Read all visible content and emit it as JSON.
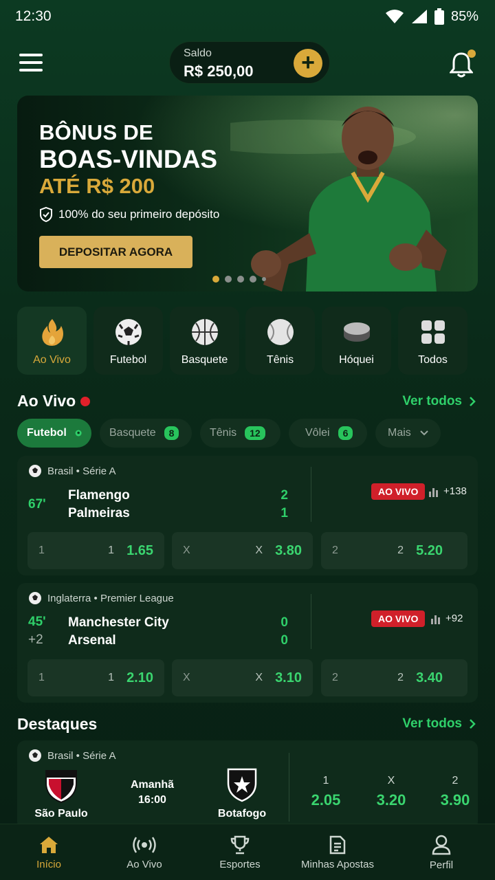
{
  "status_bar": {
    "time": "12:30",
    "battery": "85%"
  },
  "header": {
    "balance_label": "Saldo",
    "balance_value": "R$ 250,00",
    "add_label": "+"
  },
  "banner": {
    "title_line1": "BÔNUS DE",
    "title_line2": "BOAS-VINDAS",
    "title_line3": "ATÉ R$ 200",
    "subtitle": "100% do seu primeiro depósito",
    "cta": "DEPOSITAR AGORA",
    "slides": 5,
    "active_slide": 1
  },
  "categories": [
    {
      "label": "Ao Vivo",
      "icon": "flame-icon",
      "active": true
    },
    {
      "label": "Futebol",
      "icon": "soccer-ball-icon",
      "active": false
    },
    {
      "label": "Basquete",
      "icon": "basketball-icon",
      "active": false
    },
    {
      "label": "Tênis",
      "icon": "tennis-ball-icon",
      "active": false
    },
    {
      "label": "Hóquei",
      "icon": "hockey-puck-icon",
      "active": false
    },
    {
      "label": "Todos",
      "icon": "grid-icon",
      "active": false
    }
  ],
  "live": {
    "title": "Ao Vivo",
    "see_all": "Ver todos",
    "chips": [
      {
        "label": "Futebol",
        "count": "",
        "active": true
      },
      {
        "label": "Basquete",
        "count": "8",
        "active": false
      },
      {
        "label": "Tênis",
        "count": "12",
        "active": false
      },
      {
        "label": "Vôlei",
        "count": "6",
        "active": false
      },
      {
        "label": "Mais",
        "count": "",
        "active": false
      }
    ],
    "matches": [
      {
        "league": "Brasil • Série A",
        "minute": "67'",
        "extra": "",
        "home": "Flamengo",
        "away": "Palmeiras",
        "home_score": "2",
        "away_score": "1",
        "badge": "AO VIVO",
        "markets": "+138",
        "odds": [
          {
            "key": "1",
            "key2": "1",
            "value": "1.65"
          },
          {
            "key": "X",
            "key2": "X",
            "value": "3.80"
          },
          {
            "key": "2",
            "key2": "2",
            "value": "5.20"
          }
        ]
      },
      {
        "league": "Inglaterra • Premier League",
        "minute": "45'",
        "extra": "+2",
        "home": "Manchester City",
        "away": "Arsenal",
        "home_score": "0",
        "away_score": "0",
        "badge": "AO VIVO",
        "markets": "+92",
        "odds": [
          {
            "key": "1",
            "key2": "1",
            "value": "2.10"
          },
          {
            "key": "X",
            "key2": "X",
            "value": "3.10"
          },
          {
            "key": "2",
            "key2": "2",
            "value": "3.40"
          }
        ]
      }
    ]
  },
  "featured": {
    "title": "Destaques",
    "see_all": "Ver todos",
    "league": "Brasil • Série A",
    "home": "São Paulo",
    "away": "Botafogo",
    "day": "Amanhã",
    "time": "16:00",
    "odds": [
      {
        "key": "1",
        "value": "2.05"
      },
      {
        "key": "X",
        "value": "3.20"
      },
      {
        "key": "2",
        "value": "3.90"
      }
    ]
  },
  "bottom_nav": [
    {
      "label": "Início",
      "icon": "home-icon",
      "active": true
    },
    {
      "label": "Ao Vivo",
      "icon": "broadcast-icon",
      "active": false
    },
    {
      "label": "Esportes",
      "icon": "trophy-icon",
      "active": false
    },
    {
      "label": "Minhas Apostas",
      "icon": "betslip-icon",
      "active": false
    },
    {
      "label": "Perfil",
      "icon": "profile-icon",
      "active": false
    }
  ],
  "colors": {
    "accent": "#d9a93a",
    "live_green": "#2fd06a",
    "live_red": "#d0202a"
  }
}
